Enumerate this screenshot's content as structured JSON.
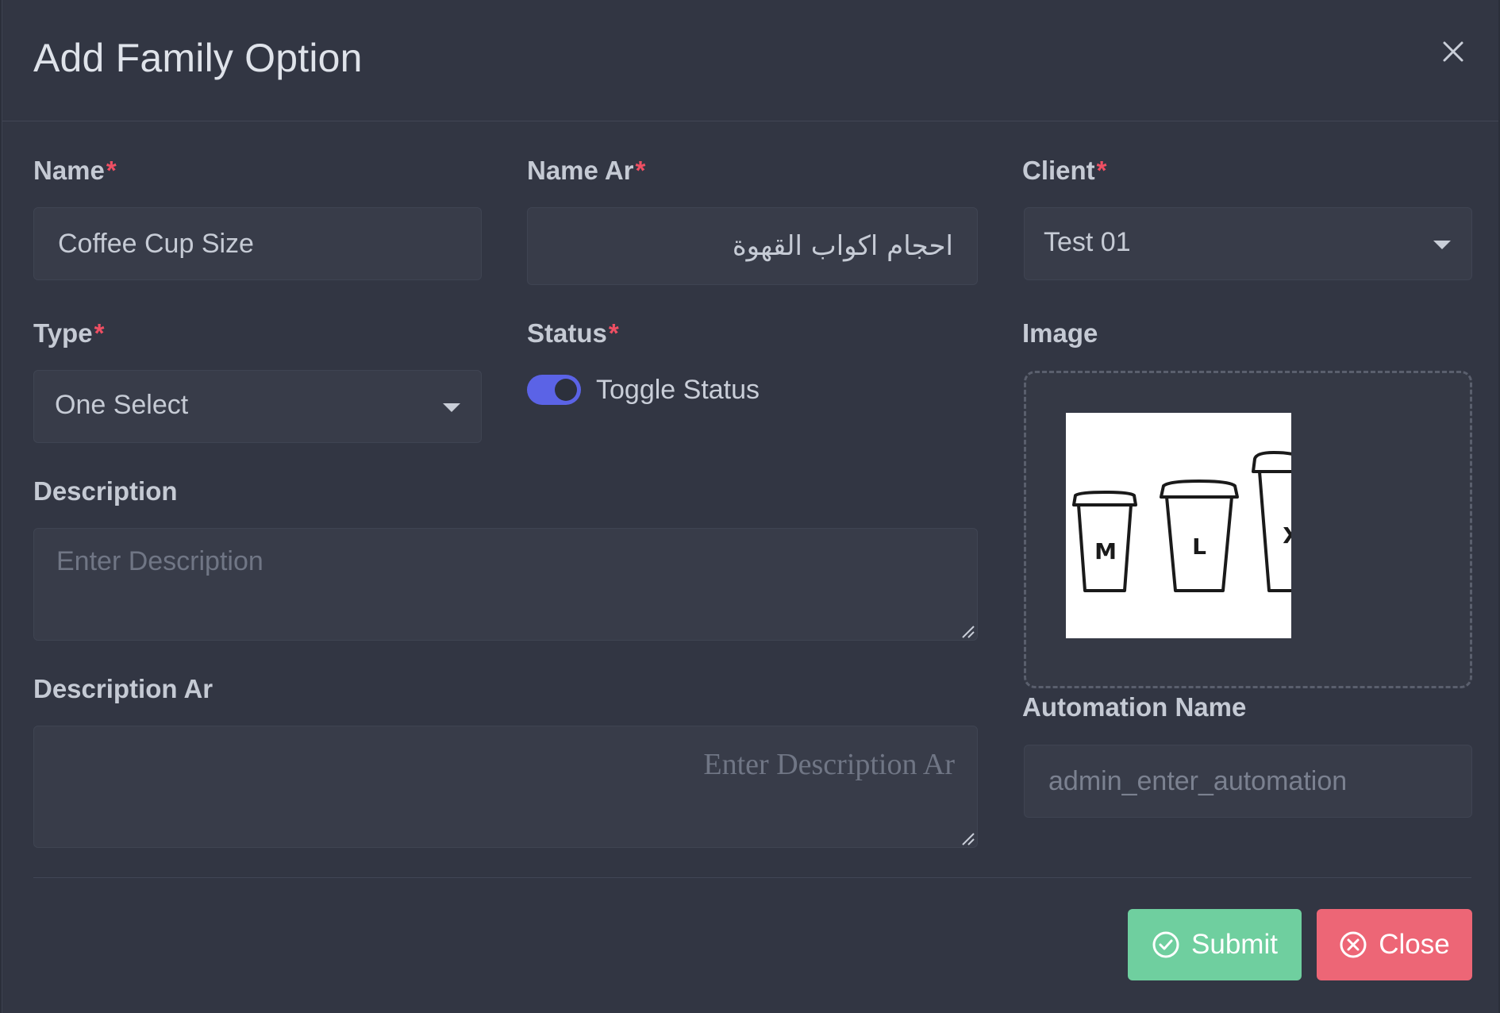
{
  "modal": {
    "title": "Add Family Option"
  },
  "fields": {
    "name": {
      "label": "Name",
      "required_mark": "*",
      "value": "Coffee Cup Size"
    },
    "name_ar": {
      "label": "Name Ar",
      "required_mark": "*",
      "value": "احجام اكواب القهوة"
    },
    "client": {
      "label": "Client",
      "required_mark": "*",
      "value": "Test 01"
    },
    "type": {
      "label": "Type",
      "required_mark": "*",
      "value": "One Select"
    },
    "status": {
      "label": "Status",
      "required_mark": "*",
      "toggle_label": "Toggle Status",
      "checked": true
    },
    "image": {
      "label": "Image",
      "cup_labels": [
        "M",
        "L",
        "X"
      ]
    },
    "description": {
      "label": "Description",
      "placeholder": "Enter Description",
      "value": ""
    },
    "description_ar": {
      "label": "Description Ar",
      "placeholder": "Enter Description Ar",
      "value": ""
    },
    "automation_name": {
      "label": "Automation Name",
      "placeholder": "admin_enter_automation",
      "value": ""
    }
  },
  "buttons": {
    "submit": "Submit",
    "close": "Close"
  },
  "colors": {
    "background": "#323643",
    "required": "#ef4f63",
    "toggle_on": "#5b63e6",
    "submit": "#6fcf9f",
    "close": "#ed6676"
  },
  "icons": {
    "header_close": "close-icon",
    "submit": "check-circle-icon",
    "close": "x-circle-icon",
    "select_caret": "caret-down-icon"
  }
}
